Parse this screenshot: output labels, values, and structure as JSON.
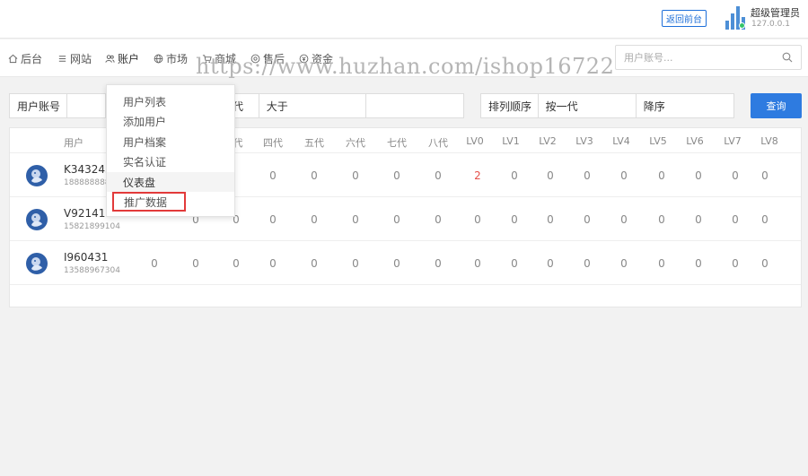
{
  "topbar": {
    "back_label": "返回前台",
    "admin_name": "超级管理员",
    "admin_ip": "127.0.0.1"
  },
  "nav": {
    "items": [
      {
        "label": "后台",
        "icon": "home-icon"
      },
      {
        "label": "网站",
        "icon": "list-icon"
      },
      {
        "label": "账户",
        "icon": "users-icon"
      },
      {
        "label": "市场",
        "icon": "globe-icon"
      },
      {
        "label": "商城",
        "icon": "cart-icon"
      },
      {
        "label": "售后",
        "icon": "service-icon"
      },
      {
        "label": "资金",
        "icon": "money-icon"
      }
    ],
    "search_placeholder": "用户账号..."
  },
  "watermark": "https://www.huzhan.com/ishop16722",
  "dropdown": {
    "items": [
      "用户列表",
      "添加用户",
      "用户档案",
      "实名认证",
      "仪表盘",
      "推广数据"
    ]
  },
  "filters": {
    "account_label": "用户账号",
    "level_partial": "代",
    "compare": "大于",
    "sort_label": "排列顺序",
    "sort_by": "按一代",
    "sort_dir": "降序",
    "query_label": "查询"
  },
  "table": {
    "user_header": "用户",
    "level_header_partial": "代",
    "headers": [
      "四代",
      "五代",
      "六代",
      "七代",
      "八代",
      "LV0",
      "LV1",
      "LV2",
      "LV3",
      "LV4",
      "LV5",
      "LV6",
      "LV7",
      "LV8"
    ],
    "rows": [
      {
        "name": "K343243",
        "phone": "188888888",
        "hidden": [],
        "values": [
          "0",
          "0",
          "0",
          "0",
          "0",
          "2",
          "0",
          "0",
          "0",
          "0",
          "0",
          "0",
          "0",
          "0"
        ]
      },
      {
        "name": "V921410",
        "phone": "15821899104",
        "hidden": [
          "0",
          "0",
          "0"
        ],
        "values": [
          "0",
          "0",
          "0",
          "0",
          "0",
          "0",
          "0",
          "0",
          "0",
          "0",
          "0",
          "0",
          "0",
          "0"
        ]
      },
      {
        "name": "I960431",
        "phone": "13588967304",
        "hidden": [
          "0",
          "0",
          "0"
        ],
        "values": [
          "0",
          "0",
          "0",
          "0",
          "0",
          "0",
          "0",
          "0",
          "0",
          "0",
          "0",
          "0",
          "0",
          "0"
        ]
      }
    ]
  },
  "colors": {
    "accent": "#2e7be0",
    "highlight_border": "#e23a3a",
    "positive_value": "#e5504a"
  }
}
